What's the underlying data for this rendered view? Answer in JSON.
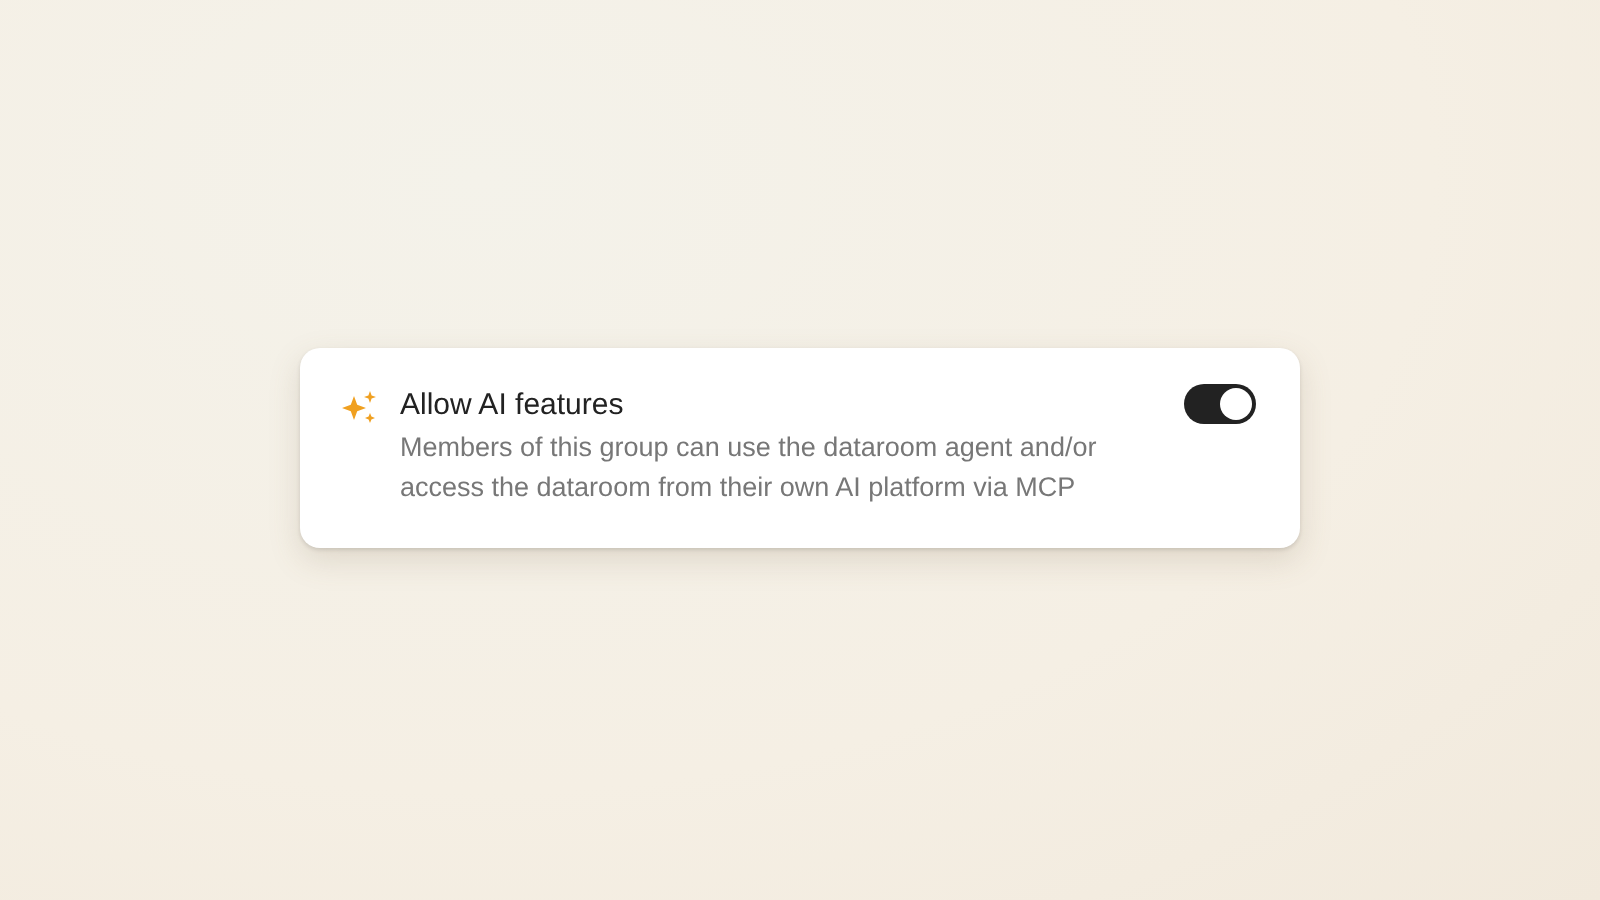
{
  "setting": {
    "title": "Allow AI features",
    "description": "Members of this group can use the dataroom agent and/or access the dataroom from their own AI platform via MCP",
    "on": true
  }
}
